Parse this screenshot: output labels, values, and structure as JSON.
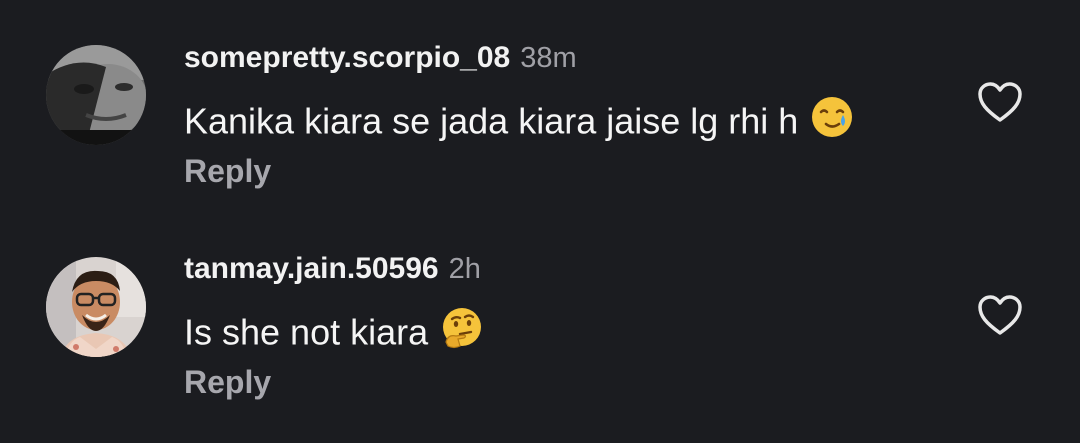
{
  "comments": [
    {
      "username": "somepretty.scorpio_08",
      "time": "38m",
      "text": "Kanika kiara se jada kiara jaise lg rhi h",
      "emoji": "smiling-face-with-tear",
      "reply_label": "Reply",
      "like_icon": "heart-outline-icon"
    },
    {
      "username": "tanmay.jain.50596",
      "time": "2h",
      "text": "Is she not kiara",
      "emoji": "thinking-face",
      "reply_label": "Reply",
      "like_icon": "heart-outline-icon"
    }
  ],
  "colors": {
    "background": "#1b1c20",
    "username": "#f2f2f2",
    "secondary_text": "#a0a0a6",
    "emoji_yellow": "#f5c33b"
  }
}
